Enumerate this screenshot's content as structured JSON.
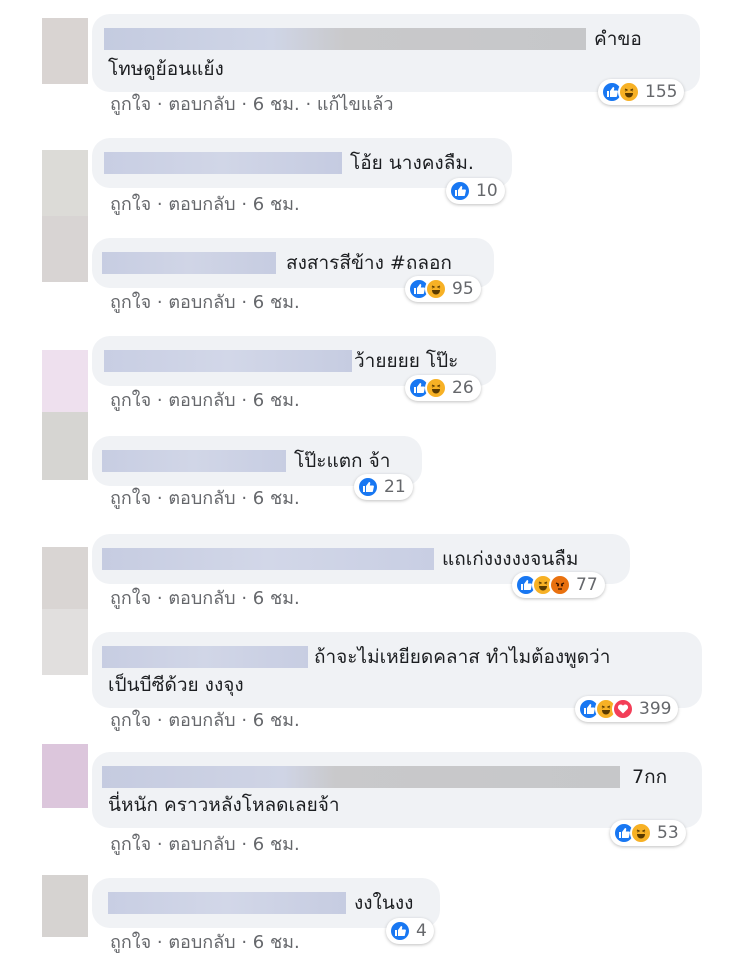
{
  "comments": [
    {
      "text_lines": [
        "คำขอ",
        "โทษดูย้อนแย้ง"
      ],
      "actions": [
        "ถูกใจ",
        "ตอบกลับ",
        "6 ชม.",
        "แก้ไขแล้ว"
      ],
      "reactions": [
        "like-icon",
        "haha-icon"
      ],
      "count": "155"
    },
    {
      "text_lines": [
        "โอ้ย นางคงลืม."
      ],
      "actions": [
        "ถูกใจ",
        "ตอบกลับ",
        "6 ชม."
      ],
      "reactions": [
        "like-icon"
      ],
      "count": "10"
    },
    {
      "text_lines": [
        "สงสารสีข้าง #ถลอก"
      ],
      "actions": [
        "ถูกใจ",
        "ตอบกลับ",
        "6 ชม."
      ],
      "reactions": [
        "like-icon",
        "haha-icon"
      ],
      "count": "95"
    },
    {
      "text_lines": [
        "ว้ายยยย โป๊ะ"
      ],
      "actions": [
        "ถูกใจ",
        "ตอบกลับ",
        "6 ชม."
      ],
      "reactions": [
        "like-icon",
        "haha-icon"
      ],
      "count": "26"
    },
    {
      "text_lines": [
        "โป๊ะแตก จ้า"
      ],
      "actions": [
        "ถูกใจ",
        "ตอบกลับ",
        "6 ชม."
      ],
      "reactions": [
        "like-icon"
      ],
      "count": "21"
    },
    {
      "text_lines": [
        "แถเก่งงงงงจนลืม"
      ],
      "actions": [
        "ถูกใจ",
        "ตอบกลับ",
        "6 ชม."
      ],
      "reactions": [
        "like-icon",
        "haha-icon",
        "angry-icon"
      ],
      "count": "77"
    },
    {
      "text_lines": [
        "ถ้าจะไม่เหยียดคลาส ทำไมต้องพูดว่า",
        "เป็นบีซีด้วย งงจุง"
      ],
      "actions": [
        "ถูกใจ",
        "ตอบกลับ",
        "6 ชม."
      ],
      "reactions": [
        "like-icon",
        "haha-icon",
        "love-icon"
      ],
      "count": "399"
    },
    {
      "text_lines": [
        "7กก",
        "นี่หนัก คราวหลังโหลดเลยจ้า"
      ],
      "actions": [
        "ถูกใจ",
        "ตอบกลับ",
        "6 ชม."
      ],
      "reactions": [
        "like-icon",
        "haha-icon"
      ],
      "count": "53"
    },
    {
      "text_lines": [
        "งงในงง"
      ],
      "actions": [
        "ถูกใจ",
        "ตอบกลับ",
        "6 ชม."
      ],
      "reactions": [
        "like-icon"
      ],
      "count": "4"
    }
  ],
  "colors": {
    "bubble": "#f0f2f5",
    "action_text": "#65676b",
    "like": "#1877f2",
    "haha": "#f7b125",
    "angry": "#e9710f",
    "love": "#f33e58",
    "redaction": "#c9cfe3"
  }
}
